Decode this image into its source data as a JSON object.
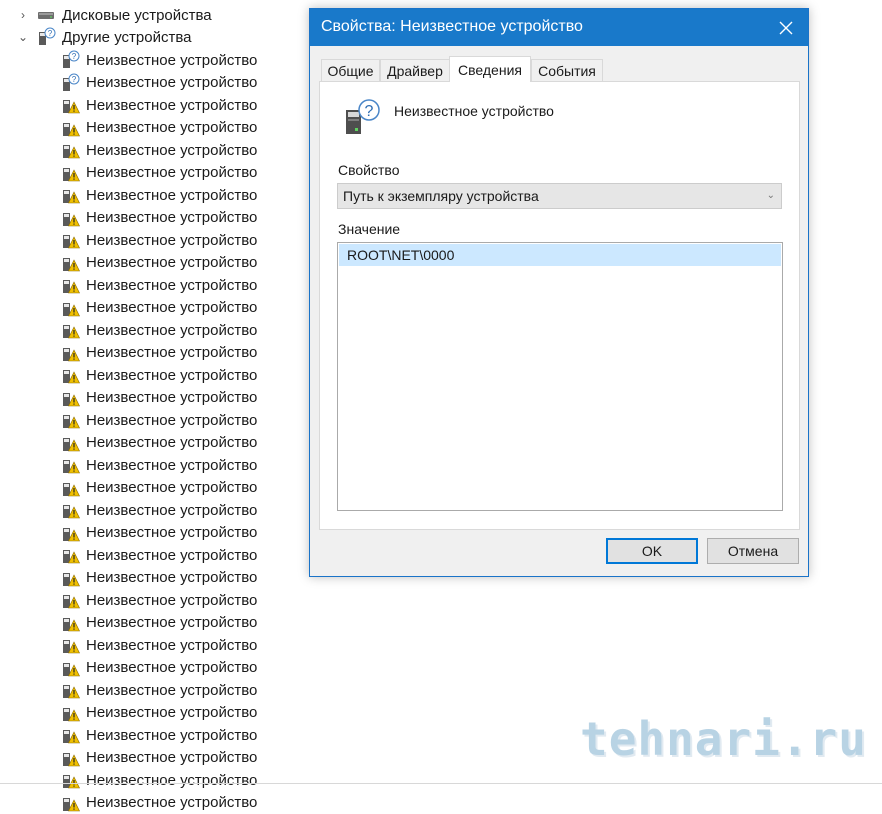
{
  "tree": {
    "categories": [
      {
        "label": "Дисковые устройства",
        "expanded": false,
        "icon": "disk-drive-icon"
      },
      {
        "label": "Другие устройства",
        "expanded": true,
        "icon": "unknown-device-icon"
      }
    ],
    "devices": [
      {
        "label": "Неизвестное устройство",
        "icon": "unknown-device-icon"
      },
      {
        "label": "Неизвестное устройство",
        "icon": "unknown-device-icon"
      },
      {
        "label": "Неизвестное устройство",
        "icon": "unknown-device-warning-icon"
      },
      {
        "label": "Неизвестное устройство",
        "icon": "unknown-device-warning-icon"
      },
      {
        "label": "Неизвестное устройство",
        "icon": "unknown-device-warning-icon"
      },
      {
        "label": "Неизвестное устройство",
        "icon": "unknown-device-warning-icon"
      },
      {
        "label": "Неизвестное устройство",
        "icon": "unknown-device-warning-icon"
      },
      {
        "label": "Неизвестное устройство",
        "icon": "unknown-device-warning-icon"
      },
      {
        "label": "Неизвестное устройство",
        "icon": "unknown-device-warning-icon"
      },
      {
        "label": "Неизвестное устройство",
        "icon": "unknown-device-warning-icon"
      },
      {
        "label": "Неизвестное устройство",
        "icon": "unknown-device-warning-icon"
      },
      {
        "label": "Неизвестное устройство",
        "icon": "unknown-device-warning-icon"
      },
      {
        "label": "Неизвестное устройство",
        "icon": "unknown-device-warning-icon"
      },
      {
        "label": "Неизвестное устройство",
        "icon": "unknown-device-warning-icon"
      },
      {
        "label": "Неизвестное устройство",
        "icon": "unknown-device-warning-icon"
      },
      {
        "label": "Неизвестное устройство",
        "icon": "unknown-device-warning-icon"
      },
      {
        "label": "Неизвестное устройство",
        "icon": "unknown-device-warning-icon"
      },
      {
        "label": "Неизвестное устройство",
        "icon": "unknown-device-warning-icon"
      },
      {
        "label": "Неизвестное устройство",
        "icon": "unknown-device-warning-icon"
      },
      {
        "label": "Неизвестное устройство",
        "icon": "unknown-device-warning-icon"
      },
      {
        "label": "Неизвестное устройство",
        "icon": "unknown-device-warning-icon"
      },
      {
        "label": "Неизвестное устройство",
        "icon": "unknown-device-warning-icon"
      },
      {
        "label": "Неизвестное устройство",
        "icon": "unknown-device-warning-icon"
      },
      {
        "label": "Неизвестное устройство",
        "icon": "unknown-device-warning-icon"
      },
      {
        "label": "Неизвестное устройство",
        "icon": "unknown-device-warning-icon"
      },
      {
        "label": "Неизвестное устройство",
        "icon": "unknown-device-warning-icon"
      },
      {
        "label": "Неизвестное устройство",
        "icon": "unknown-device-warning-icon"
      },
      {
        "label": "Неизвестное устройство",
        "icon": "unknown-device-warning-icon"
      },
      {
        "label": "Неизвестное устройство",
        "icon": "unknown-device-warning-icon"
      },
      {
        "label": "Неизвестное устройство",
        "icon": "unknown-device-warning-icon"
      },
      {
        "label": "Неизвестное устройство",
        "icon": "unknown-device-warning-icon"
      },
      {
        "label": "Неизвестное устройство",
        "icon": "unknown-device-warning-icon"
      },
      {
        "label": "Неизвестное устройство",
        "icon": "unknown-device-warning-icon"
      },
      {
        "label": "Неизвестное устройство",
        "icon": "unknown-device-warning-icon"
      }
    ]
  },
  "dialog": {
    "title": "Свойства: Неизвестное устройство",
    "tabs": [
      {
        "label": "Общие",
        "active": false
      },
      {
        "label": "Драйвер",
        "active": false
      },
      {
        "label": "Сведения",
        "active": true
      },
      {
        "label": "События",
        "active": false
      }
    ],
    "device_name": "Неизвестное устройство",
    "property_label": "Свойство",
    "property_selected": "Путь к экземпляру устройства",
    "value_label": "Значение",
    "values": [
      "ROOT\\NET\\0000"
    ],
    "ok_label": "OK",
    "cancel_label": "Отмена"
  },
  "watermark": "tehnari.ru",
  "colors": {
    "titlebar": "#1979ca",
    "selection": "#cce8ff",
    "default_button_border": "#0078d7",
    "watermark": "#7fb0cf"
  }
}
